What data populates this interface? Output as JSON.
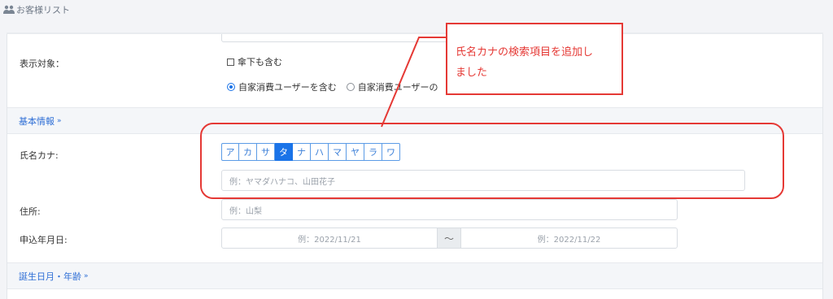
{
  "page": {
    "title": "お客様リスト"
  },
  "display_target": {
    "label": "表示対象：",
    "checkbox_label": "傘下も含む",
    "radio_include": "自家消費ユーザーを含む",
    "radio_exclude": "自家消費ユーザーの"
  },
  "sections": {
    "basic_info": "基本情報",
    "birthday_age": "誕生日月・年齢"
  },
  "fields": {
    "kana_label": "氏名カナ:",
    "kana_buttons": [
      "ア",
      "カ",
      "サ",
      "タ",
      "ナ",
      "ハ",
      "マ",
      "ヤ",
      "ラ",
      "ワ"
    ],
    "kana_active": "タ",
    "kana_placeholder": "例：ヤマダハナコ、山田花子",
    "address_label": "住所:",
    "address_placeholder": "例：山梨",
    "apply_date_label": "申込年月日:",
    "date_from_placeholder": "例：2022/11/21",
    "date_separator": "〜",
    "date_to_placeholder": "例：2022/11/22"
  },
  "annotation": {
    "line1": "氏名カナの検索項目を追加し",
    "line2": "ました",
    "color": "#e53935"
  },
  "colors": {
    "accent": "#1a73e8",
    "section_text": "#2f6fd6"
  }
}
